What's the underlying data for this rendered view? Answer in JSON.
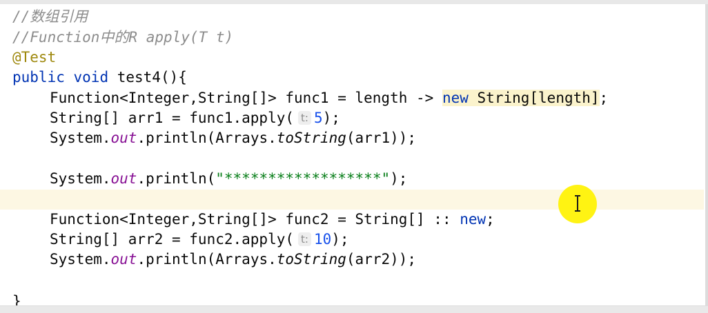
{
  "editor": {
    "lines": {
      "l1": {
        "comment": "//数组引用"
      },
      "l2": {
        "comment": "//Function中的R apply(T t)"
      },
      "l3": {
        "annotation": "@Test"
      },
      "l4": {
        "kw1": "public",
        "kw2": "void",
        "rest": " test4(){"
      },
      "l5": {
        "pre": "Function<Integer,String[]> func1 = length -> ",
        "kw": "new",
        "post": " String[length]",
        "end": ";"
      },
      "l6": {
        "pre": "String[] arr1 = func1.apply(",
        "hint": "t:",
        "num": "5",
        "end": ");"
      },
      "l7": {
        "a": "System.",
        "out": "out",
        "b": ".println(Arrays.",
        "tostr": "toString",
        "c": "(arr1));"
      },
      "l9": {
        "a": "System.",
        "out": "out",
        "b": ".println(",
        "str": "\"******************\"",
        "c": ");"
      },
      "l11": {
        "pre": "Function<Integer,String[]> func2 = String[] :: ",
        "kw": "new",
        "end": ";"
      },
      "l12": {
        "pre": "String[] arr2 = func2.apply(",
        "hint": "t:",
        "num": "10",
        "end": ");"
      },
      "l13": {
        "a": "System.",
        "out": "out",
        "b": ".println(Arrays.",
        "tostr": "toString",
        "c": "(arr2));"
      },
      "l15": {
        "brace": "}"
      }
    },
    "colors": {
      "keyword": "#0033b3",
      "comment": "#8c8c8c",
      "annotation": "#9e880d",
      "string": "#067d17",
      "number": "#1750eb",
      "static_field": "#871094",
      "current_line": "#fdf7e3"
    },
    "cursor": {
      "icon": "text-cursor-icon",
      "highlight_color": "#fff200"
    }
  }
}
